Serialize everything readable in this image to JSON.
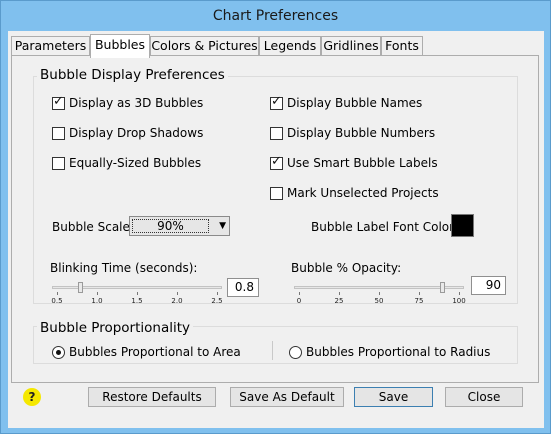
{
  "window": {
    "title": "Chart Preferences"
  },
  "tabs": [
    {
      "label": "Parameters"
    },
    {
      "label": "Bubbles"
    },
    {
      "label": "Colors & Pictures"
    },
    {
      "label": "Legends"
    },
    {
      "label": "Gridlines"
    },
    {
      "label": "Fonts"
    }
  ],
  "active_tab": "Bubbles",
  "display_prefs": {
    "title": "Bubble Display Preferences",
    "options": [
      {
        "label": "Display as 3D Bubbles",
        "checked": true
      },
      {
        "label": "Display Drop Shadows",
        "checked": false
      },
      {
        "label": "Equally-Sized Bubbles",
        "checked": false
      },
      {
        "label": "Display Bubble Names",
        "checked": true
      },
      {
        "label": "Display Bubble Numbers",
        "checked": false
      },
      {
        "label": "Use Smart Bubble Labels",
        "checked": true
      },
      {
        "label": "Mark Unselected Projects",
        "checked": false
      }
    ],
    "bubble_scale": {
      "label": "Bubble Scale:",
      "value": "90%"
    },
    "label_font_color": {
      "label": "Bubble Label Font Color:",
      "color": "#000000"
    },
    "blinking": {
      "label": "Blinking Time (seconds):",
      "value": "0.8",
      "slider_value": 0.8,
      "min": 0.5,
      "max": 2.5,
      "ticks": [
        "0.5",
        "1.0",
        "1.5",
        "2.0",
        "2.5"
      ]
    },
    "opacity": {
      "label": "Bubble % Opacity:",
      "value": "90",
      "slider_value": 90,
      "min": 0,
      "max": 100,
      "ticks": [
        "0",
        "25",
        "50",
        "75",
        "100"
      ]
    }
  },
  "proportionality": {
    "title": "Bubble Proportionality",
    "options": [
      {
        "label": "Bubbles Proportional to Area",
        "selected": true
      },
      {
        "label": "Bubbles Proportional to Radius",
        "selected": false
      }
    ]
  },
  "buttons": {
    "help": "?",
    "restore": "Restore Defaults",
    "save_default": "Save As Default",
    "save": "Save",
    "close": "Close"
  }
}
